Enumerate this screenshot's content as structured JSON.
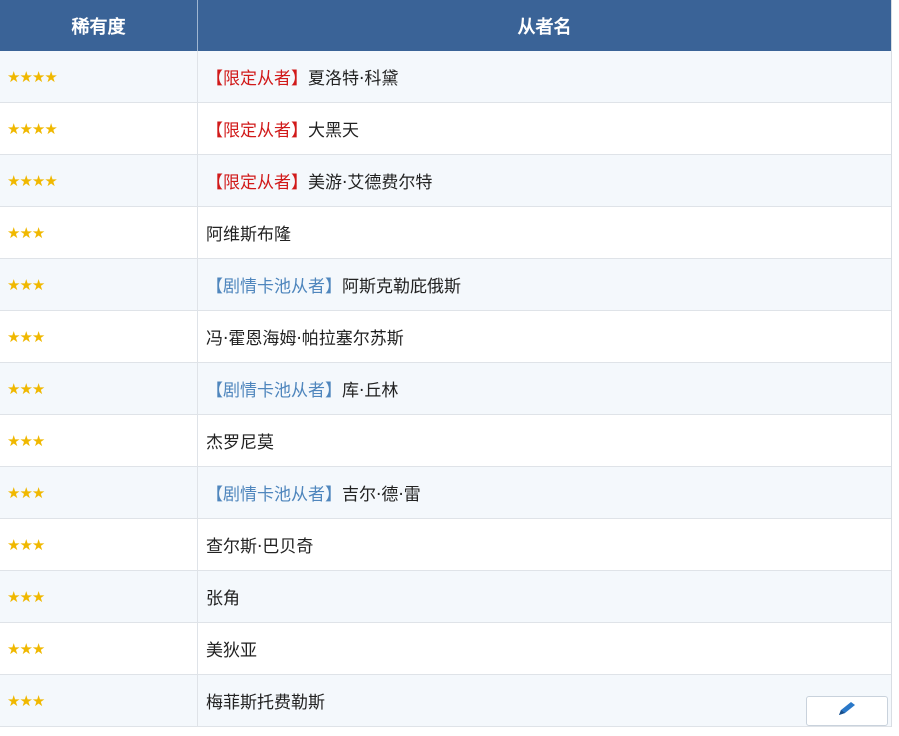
{
  "header": {
    "rarity_label": "稀有度",
    "name_label": "从者名"
  },
  "rows": [
    {
      "rarity": "★★★★",
      "tag": "【限定从者】",
      "tag_type": "limited",
      "name": "夏洛特·科黛"
    },
    {
      "rarity": "★★★★",
      "tag": "【限定从者】",
      "tag_type": "limited",
      "name": "大黑天"
    },
    {
      "rarity": "★★★★",
      "tag": "【限定从者】",
      "tag_type": "limited",
      "name": "美游·艾德费尔特"
    },
    {
      "rarity": "★★★",
      "tag": "",
      "tag_type": "",
      "name": "阿维斯布隆"
    },
    {
      "rarity": "★★★",
      "tag": "【剧情卡池从者】",
      "tag_type": "story",
      "name": "阿斯克勒庇俄斯"
    },
    {
      "rarity": "★★★",
      "tag": "",
      "tag_type": "",
      "name": "冯·霍恩海姆·帕拉塞尔苏斯"
    },
    {
      "rarity": "★★★",
      "tag": "【剧情卡池从者】",
      "tag_type": "story",
      "name": "库·丘林"
    },
    {
      "rarity": "★★★",
      "tag": "",
      "tag_type": "",
      "name": "杰罗尼莫"
    },
    {
      "rarity": "★★★",
      "tag": "【剧情卡池从者】",
      "tag_type": "story",
      "name": "吉尔·德·雷"
    },
    {
      "rarity": "★★★",
      "tag": "",
      "tag_type": "",
      "name": "查尔斯·巴贝奇"
    },
    {
      "rarity": "★★★",
      "tag": "",
      "tag_type": "",
      "name": "张角"
    },
    {
      "rarity": "★★★",
      "tag": "",
      "tag_type": "",
      "name": "美狄亚"
    },
    {
      "rarity": "★★★",
      "tag": "",
      "tag_type": "",
      "name": "梅菲斯托费勒斯"
    }
  ],
  "colors": {
    "header_bg": "#3a6397",
    "star": "#f0b800",
    "limited_tag": "#d11a1a",
    "story_tag": "#4f86bd"
  },
  "icons": {
    "float_button": "pencil-icon"
  }
}
